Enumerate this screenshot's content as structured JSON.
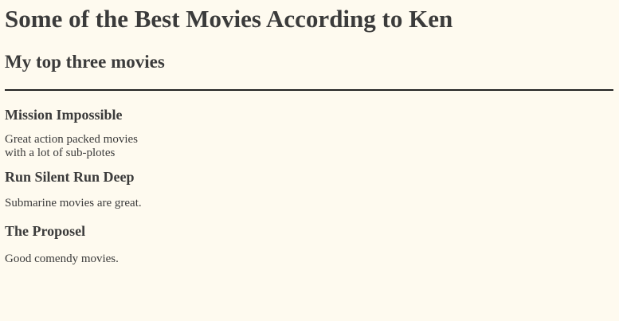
{
  "page": {
    "title": "Some of the Best Movies According to Ken",
    "subtitle": "My top three movies"
  },
  "movies": [
    {
      "title": "Mission Impossible",
      "description": "Great action packed movies\nwith a lot of sub-plotes"
    },
    {
      "title": "Run Silent Run Deep",
      "description": "Submarine movies are great."
    },
    {
      "title": "The Proposel",
      "description": "Good comendy movies."
    }
  ],
  "colors": {
    "background": "#fefaef",
    "text": "#3b3b3b",
    "rule": "#222222"
  }
}
